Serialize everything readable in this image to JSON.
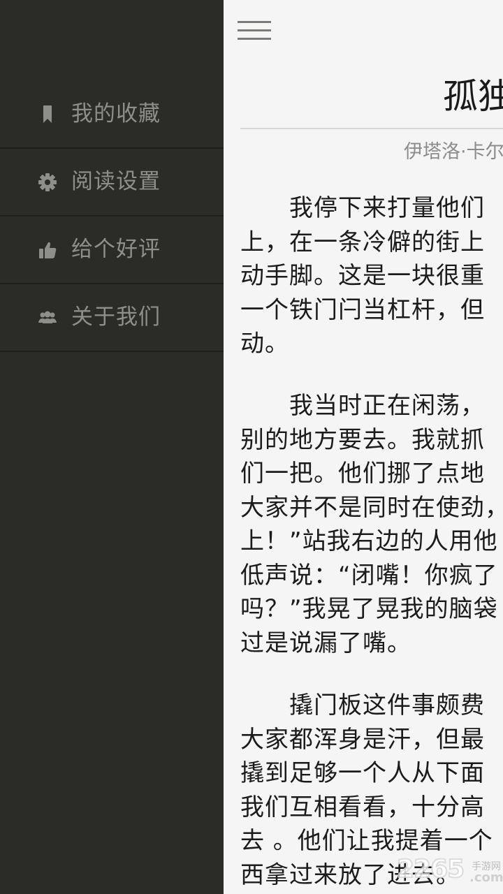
{
  "drawer": {
    "items": [
      {
        "label": "我的收藏",
        "icon": "bookmark-icon"
      },
      {
        "label": "阅读设置",
        "icon": "gear-icon"
      },
      {
        "label": "给个好评",
        "icon": "thumbs-up-icon"
      },
      {
        "label": "关于我们",
        "icon": "group-icon"
      }
    ]
  },
  "reader": {
    "menu_icon": "hamburger-menu-icon",
    "title": "孤独",
    "author": "伊塔洛·卡尔",
    "paragraphs": [
      [
        "　　我停下来打量他们",
        "上，在一条冷僻的街上",
        "动手脚。这是一块很重",
        "一个铁门闩当杠杆，但",
        "动。"
      ],
      [
        "　　我当时正在闲荡，",
        "别的地方要去。我就抓",
        "们一把。他们挪了点地",
        "大家并不是同时在使劲，",
        "上！”站我右边的人用他",
        "低声说：“闭嘴！你疯了",
        "吗？”我晃了晃我的脑袋",
        "过是说漏了嘴。"
      ],
      [
        "　　撬门板这件事颇费",
        "大家都浑身是汗，但最",
        "撬到足够一个人从下面",
        "我们互相看看，十分高",
        "去 。他们让我提着一个",
        "西拿过来放了进去。"
      ]
    ]
  },
  "watermark": {
    "main": "2265",
    "sub": "手游网",
    "domain": ".com"
  },
  "colors": {
    "drawer_bg": "#2b2b28",
    "drawer_text": "#8f8f8a",
    "content_bg": "#f5f5f5",
    "body_text": "#1b1b1b"
  }
}
